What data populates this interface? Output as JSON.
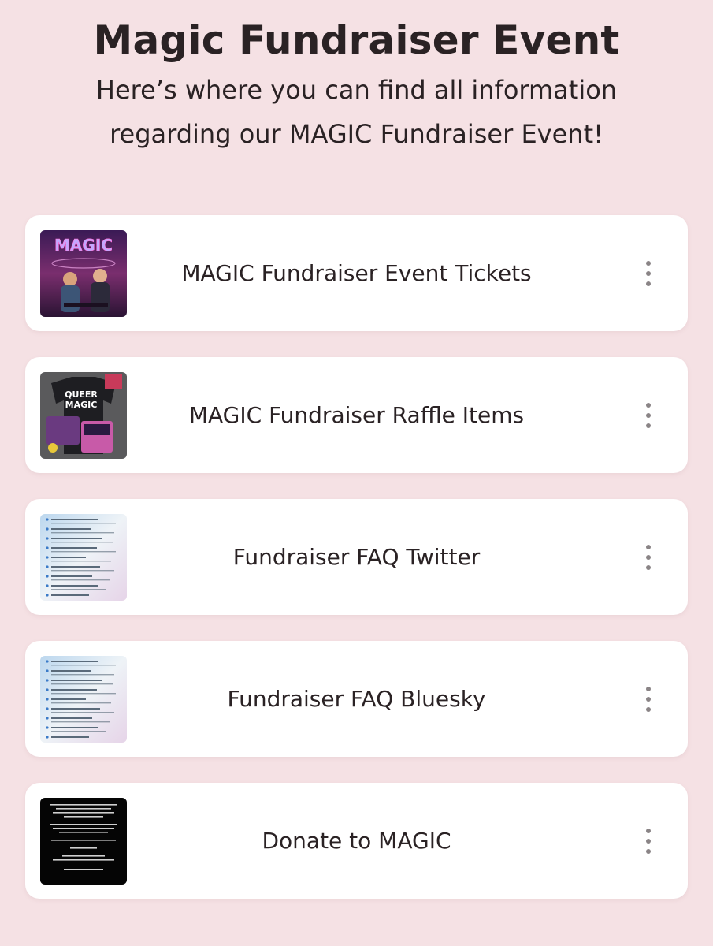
{
  "header": {
    "title": "Magic Fundraiser Event",
    "subtitle": "Here’s where you can find all information regarding our MAGIC Fundraiser Event!"
  },
  "links": [
    {
      "label": "MAGIC Fundraiser Event Tickets",
      "thumbnail": "magic-poster-image",
      "thumb_text": "MAGIC"
    },
    {
      "label": "MAGIC Fundraiser Raffle Items",
      "thumbnail": "raffle-merch-image",
      "thumb_text_1": "QUEER",
      "thumb_text_2": "MAGIC"
    },
    {
      "label": "Fundraiser FAQ Twitter",
      "thumbnail": "faq-document-image"
    },
    {
      "label": "Fundraiser FAQ Bluesky",
      "thumbnail": "faq-document-image"
    },
    {
      "label": "Donate to MAGIC",
      "thumbnail": "donate-text-image"
    }
  ],
  "menu_icon": "more-vertical-icon",
  "colors": {
    "background": "#f5e1e4",
    "card": "#ffffff",
    "text": "#2a2224",
    "icon": "#8a8486"
  }
}
